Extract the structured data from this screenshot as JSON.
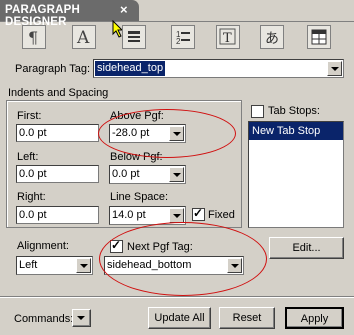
{
  "window": {
    "title": "PARAGRAPH DESIGNER",
    "close_symbol": "×"
  },
  "toolbar": {
    "icons": [
      "paragraph-icon",
      "font-icon",
      "pagination-icon",
      "numbering-icon",
      "advanced-icon",
      "asian-icon",
      "table-cell-icon"
    ]
  },
  "paragraph_tag": {
    "label": "Paragraph Tag:",
    "value": "sidehead_top"
  },
  "indents": {
    "section_label": "Indents and Spacing",
    "first_label": "First:",
    "first_value": "0.0 pt",
    "left_label": "Left:",
    "left_value": "0.0 pt",
    "right_label": "Right:",
    "right_value": "0.0 pt",
    "above_label": "Above Pgf:",
    "above_value": "-28.0 pt",
    "below_label": "Below Pgf:",
    "below_value": "0.0 pt",
    "line_space_label": "Line Space:",
    "line_space_value": "14.0 pt",
    "fixed_label": "Fixed",
    "fixed_checked": true
  },
  "tab_stops": {
    "label": "Tab Stops:",
    "checked": false,
    "items": [
      "New Tab Stop"
    ]
  },
  "alignment": {
    "label": "Alignment:",
    "value": "Left"
  },
  "next_pgf": {
    "label": "Next Pgf Tag:",
    "checked": true,
    "value": "sidehead_bottom"
  },
  "edit_button": "Edit...",
  "commands": {
    "label": "Commands:"
  },
  "buttons": {
    "update_all": "Update All",
    "reset": "Reset",
    "apply": "Apply"
  },
  "colors": {
    "tab_bg": "#6b6b6b",
    "panel_bg": "#d4d0c8",
    "selection": "#0a246a",
    "annotation": "#d01010"
  }
}
